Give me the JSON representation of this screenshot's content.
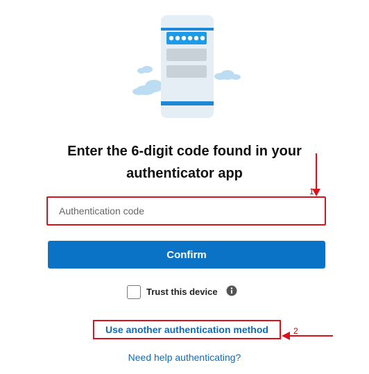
{
  "heading": {
    "line1": "Enter the 6-digit code found in your",
    "line2": "authenticator app"
  },
  "code_input": {
    "placeholder": "Authentication code",
    "value": ""
  },
  "confirm_button": {
    "label": "Confirm"
  },
  "trust_device": {
    "label": "Trust this device",
    "checked": false
  },
  "links": {
    "another_method": "Use another authentication method",
    "need_help": "Need help authenticating?"
  },
  "annotations": {
    "marker1": "1",
    "marker2": "2"
  },
  "colors": {
    "primary": "#0a73c5",
    "link": "#0a6dbf",
    "annotation_red": "#e0101a",
    "phone_body": "#e6eef5",
    "phone_accent": "#1e88d6",
    "cloud": "#bcdcf2"
  }
}
